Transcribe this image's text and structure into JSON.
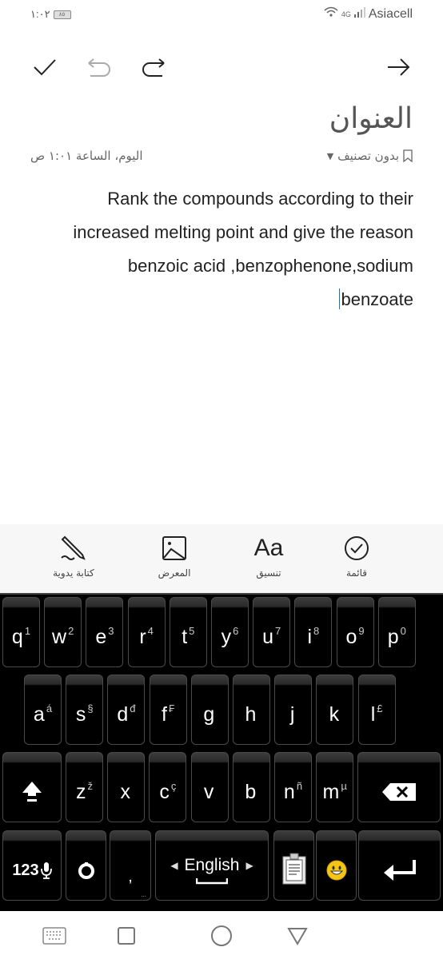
{
  "status_bar": {
    "time": "١:٠٢",
    "battery": "٨٥",
    "network": "4G",
    "carrier": "Asiacell"
  },
  "toolbar": {
    "save_icon": "checkmark-icon",
    "undo_icon": "undo-icon",
    "redo_icon": "redo-icon",
    "back_icon": "arrow-right-icon"
  },
  "note": {
    "title_placeholder": "العنوان",
    "date": "اليوم، الساعة ١:٠١ ص",
    "category": "بدون تصنيف",
    "body_lines": [
      "Rank the compounds according to their",
      "increased melting point and give the reason",
      "benzoic acid ,benzophenone,sodium",
      "benzoate"
    ]
  },
  "bottom_tools": [
    {
      "label": "قائمة",
      "icon": "checklist-icon"
    },
    {
      "label": "تنسيق",
      "icon": "format-text-icon",
      "glyph": "Aa"
    },
    {
      "label": "المعرض",
      "icon": "gallery-icon"
    },
    {
      "label": "كتابة يدوية",
      "icon": "handwriting-icon"
    }
  ],
  "keyboard": {
    "row1": [
      {
        "k": "q",
        "s": "1"
      },
      {
        "k": "w",
        "s": "2"
      },
      {
        "k": "e",
        "s": "3"
      },
      {
        "k": "r",
        "s": "4"
      },
      {
        "k": "t",
        "s": "5"
      },
      {
        "k": "y",
        "s": "6"
      },
      {
        "k": "u",
        "s": "7"
      },
      {
        "k": "i",
        "s": "8"
      },
      {
        "k": "o",
        "s": "9"
      },
      {
        "k": "p",
        "s": "0"
      }
    ],
    "row2": [
      {
        "k": "a",
        "s": "á"
      },
      {
        "k": "s",
        "s": "§"
      },
      {
        "k": "d",
        "s": "đ"
      },
      {
        "k": "f",
        "s": "₣"
      },
      {
        "k": "g",
        "s": ""
      },
      {
        "k": "h",
        "s": ""
      },
      {
        "k": "j",
        "s": ""
      },
      {
        "k": "k",
        "s": ""
      },
      {
        "k": "l",
        "s": "£"
      }
    ],
    "row3": [
      {
        "k": "z",
        "s": "ž"
      },
      {
        "k": "x",
        "s": ""
      },
      {
        "k": "c",
        "s": "ç"
      },
      {
        "k": "v",
        "s": ""
      },
      {
        "k": "b",
        "s": ""
      },
      {
        "k": "n",
        "s": "ñ"
      },
      {
        "k": "m",
        "s": "µ"
      }
    ],
    "numbers_label": "123",
    "comma": ",",
    "space_label": "English"
  }
}
